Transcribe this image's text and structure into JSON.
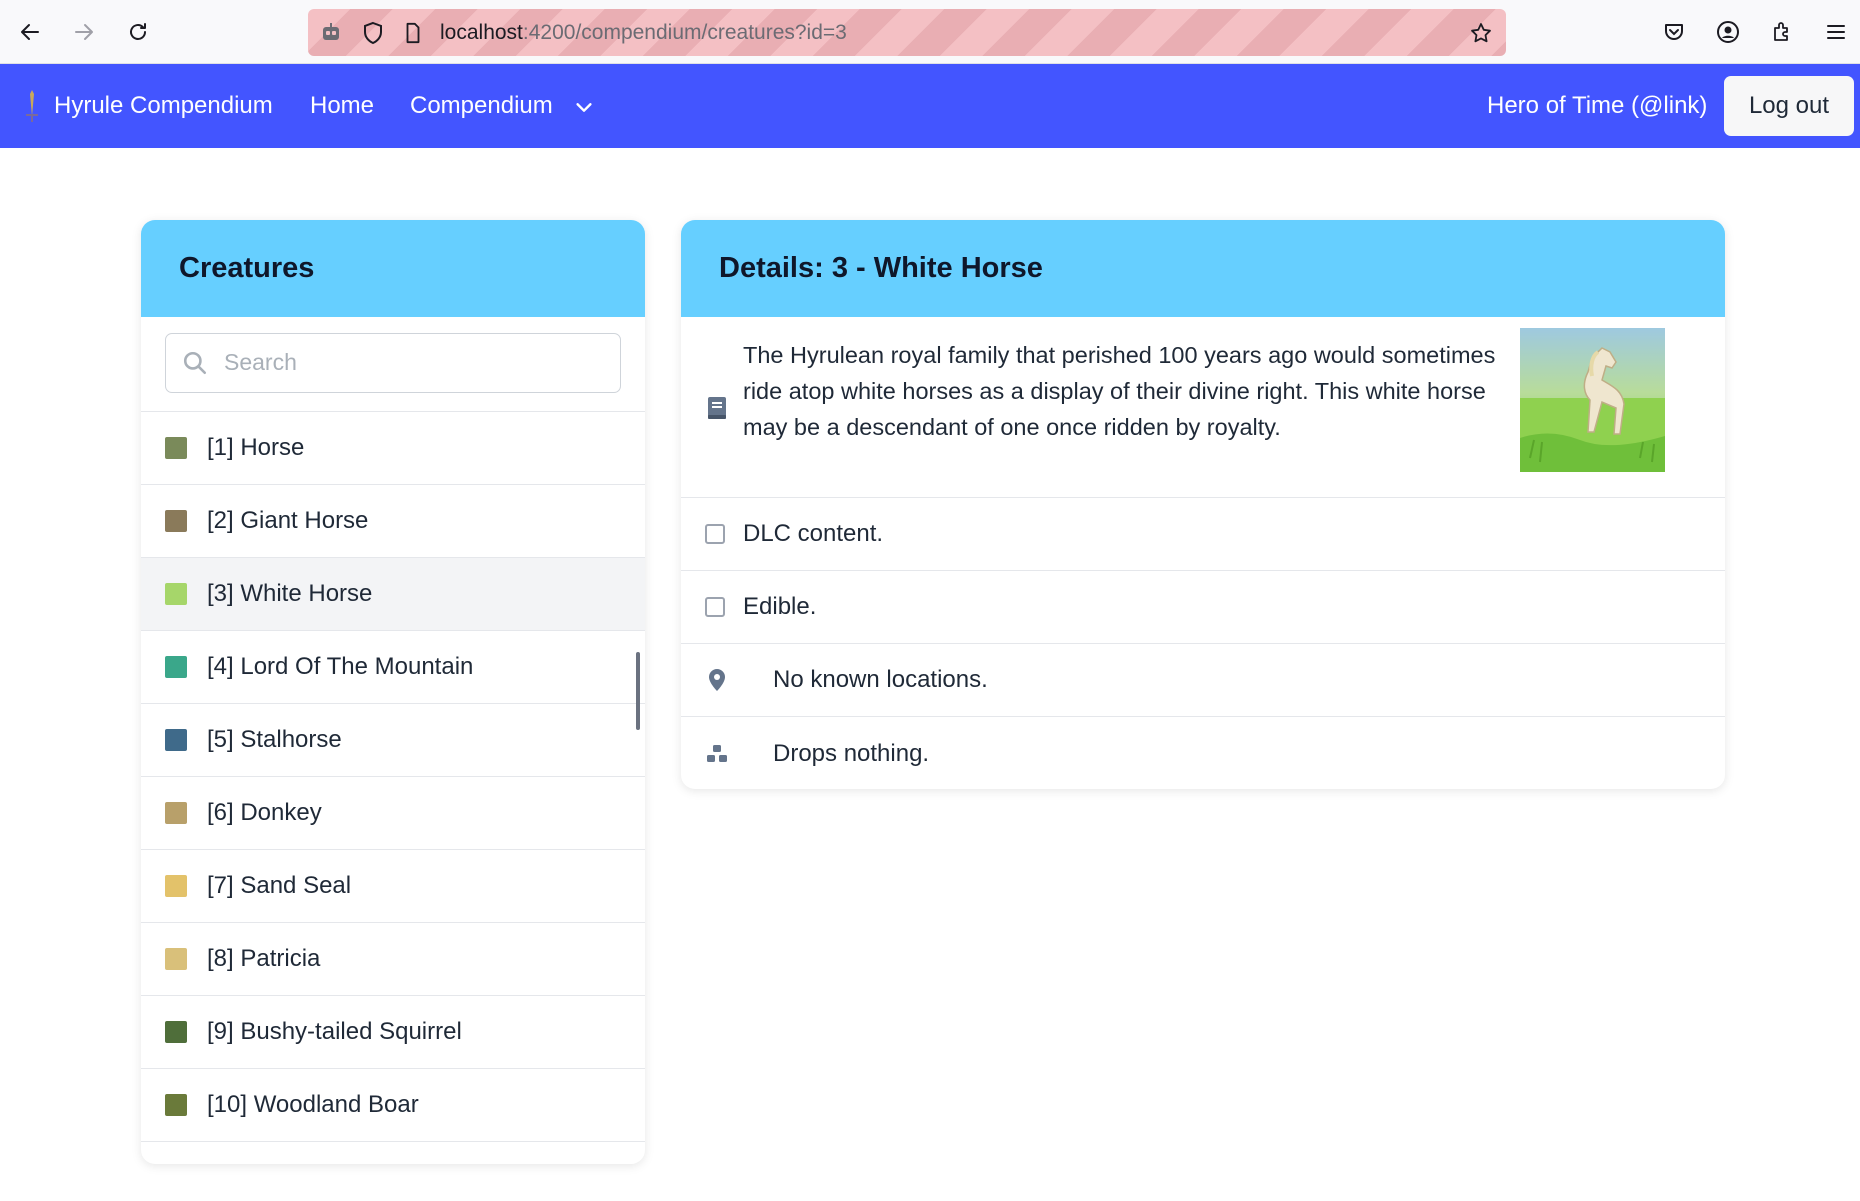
{
  "browser": {
    "url_host": "localhost",
    "url_rest": ":4200/compendium/creatures?id=3"
  },
  "navbar": {
    "brand": "Hyrule Compendium",
    "home": "Home",
    "compendium": "Compendium",
    "user": "Hero of Time (@link)",
    "logout": "Log out",
    "accent_color": "#4355ff"
  },
  "list": {
    "title": "Creatures",
    "search_placeholder": "Search",
    "items": [
      {
        "label": "[1] Horse",
        "thumb_color": "#7a8a5a"
      },
      {
        "label": "[2] Giant Horse",
        "thumb_color": "#8a7a5a"
      },
      {
        "label": "[3] White Horse",
        "thumb_color": "#a6d66a"
      },
      {
        "label": "[4] Lord Of The Mountain",
        "thumb_color": "#3aa78a"
      },
      {
        "label": "[5] Stalhorse",
        "thumb_color": "#3f6a8a"
      },
      {
        "label": "[6] Donkey",
        "thumb_color": "#b8a06a"
      },
      {
        "label": "[7] Sand Seal",
        "thumb_color": "#e3c26a"
      },
      {
        "label": "[8] Patricia",
        "thumb_color": "#d9c07a"
      },
      {
        "label": "[9] Bushy-tailed Squirrel",
        "thumb_color": "#4f6e3a"
      },
      {
        "label": "[10] Woodland Boar",
        "thumb_color": "#6a7a3a"
      }
    ]
  },
  "detail": {
    "title": "Details: 3 - White Horse",
    "description": "The Hyrulean royal family that perished 100 years ago would sometimes ride atop white horses as a display of their divine right. This white horse may be a descendant of one once ridden by royalty.",
    "dlc_label": "DLC content.",
    "edible_label": "Edible.",
    "locations": "No known locations.",
    "drops": "Drops nothing.",
    "header_color": "#66cfff"
  }
}
